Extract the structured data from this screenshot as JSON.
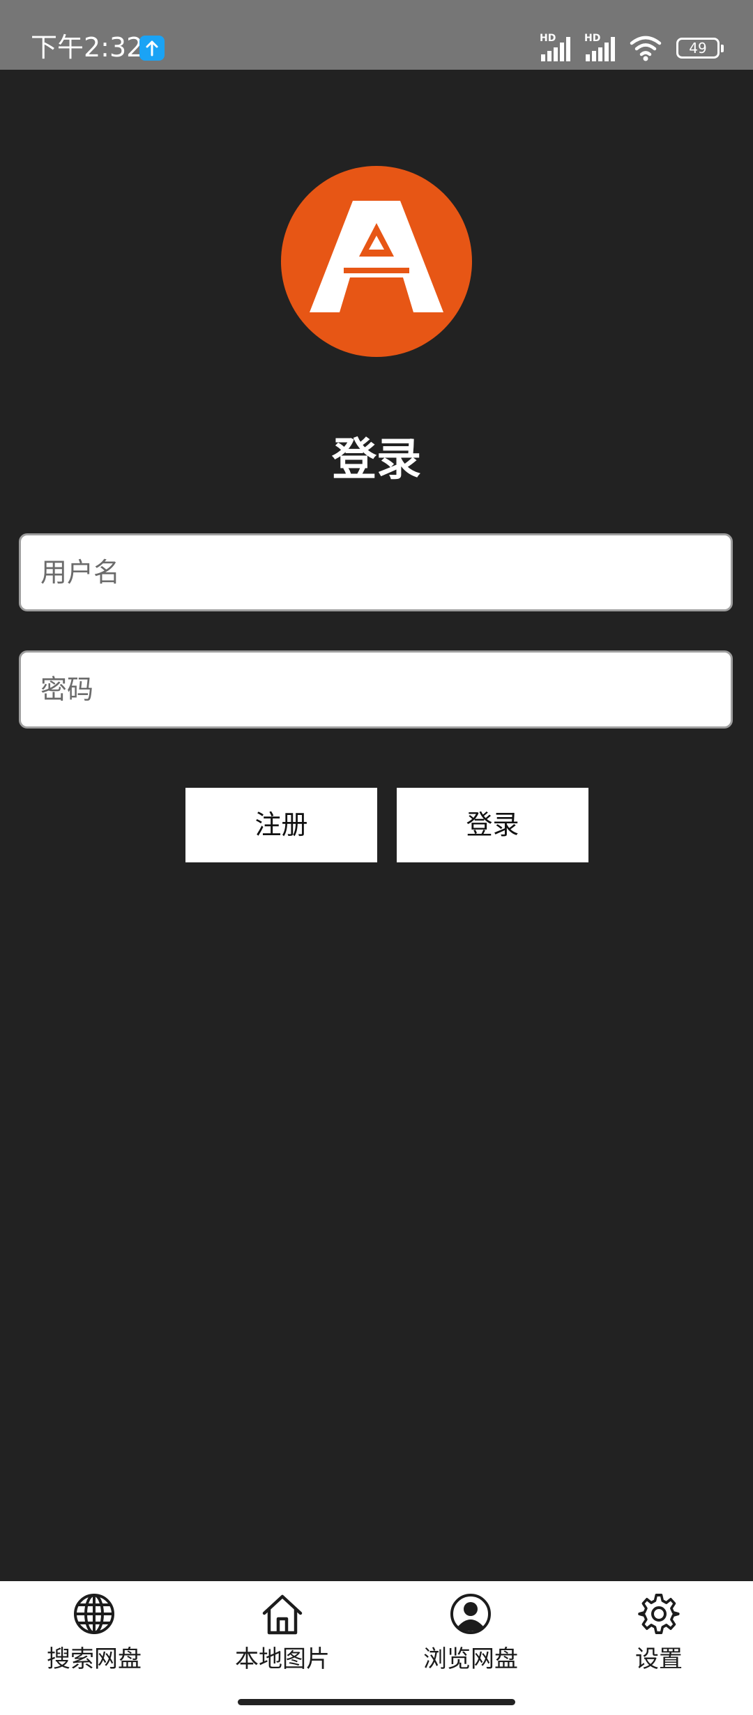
{
  "status_bar": {
    "time": "下午2:32",
    "signal_1_label": "HD",
    "signal_2_label": "HD",
    "battery_level": "49",
    "icons": [
      "upload-badge-icon",
      "signal-icon",
      "signal-icon",
      "wifi-icon",
      "battery-icon"
    ]
  },
  "logo": {
    "icon": "app-logo",
    "bg_color": "#e75615",
    "fg_color": "#ffffff"
  },
  "login": {
    "title": "登录",
    "username_placeholder": "用户名",
    "password_placeholder": "密码",
    "register_label": "注册",
    "login_label": "登录"
  },
  "nav": {
    "items": [
      {
        "label": "搜索网盘",
        "icon": "globe-icon"
      },
      {
        "label": "本地图片",
        "icon": "home-icon"
      },
      {
        "label": "浏览网盘",
        "icon": "user-circle-icon"
      },
      {
        "label": "设置",
        "icon": "gear-icon"
      }
    ]
  },
  "colors": {
    "background": "#222222",
    "status_bar": "#767676",
    "accent": "#e75615",
    "badge": "#1aa3f5"
  }
}
